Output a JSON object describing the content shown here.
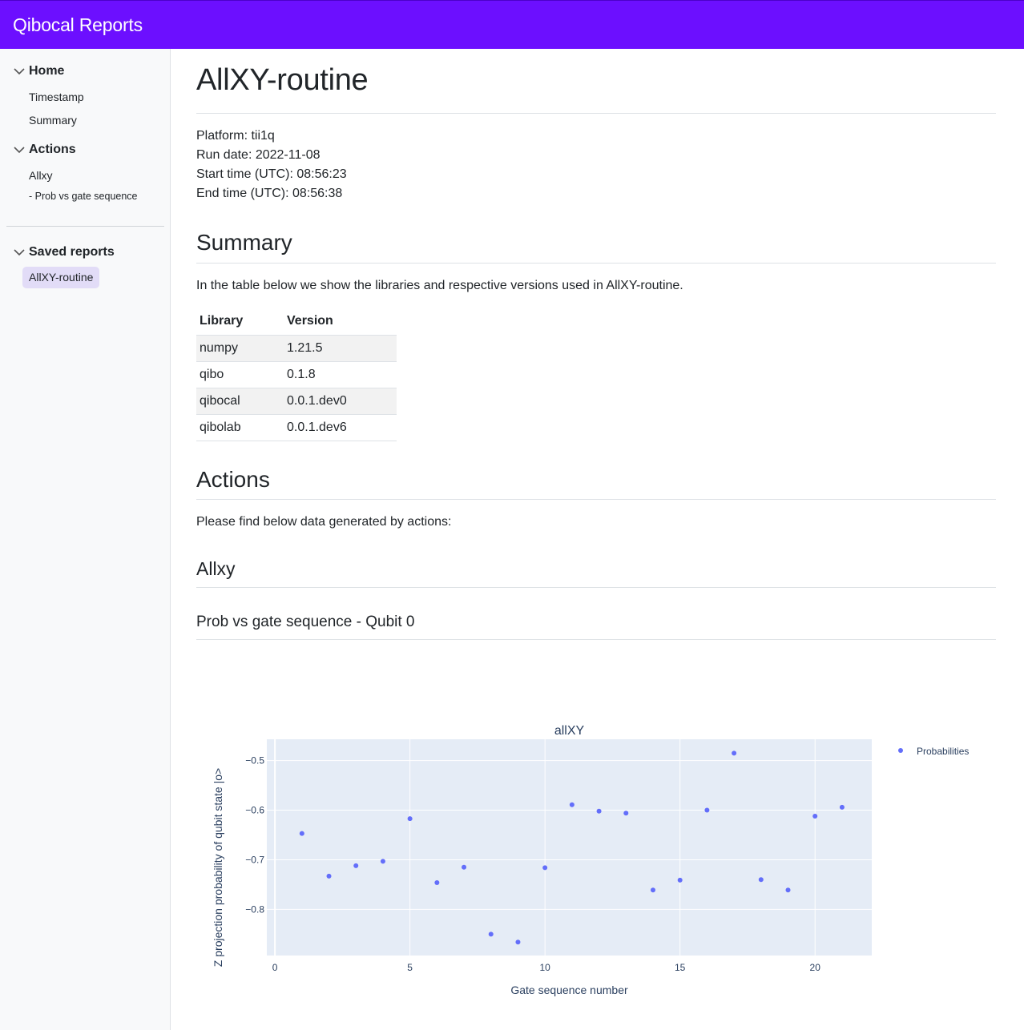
{
  "app": {
    "title": "Qibocal Reports"
  },
  "sidebar": {
    "groups": [
      {
        "label": "Home",
        "items": [
          "Timestamp",
          "Summary"
        ]
      },
      {
        "label": "Actions",
        "items": [
          "Allxy",
          "- Prob vs gate sequence"
        ]
      },
      {
        "label": "Saved reports",
        "items": [
          "AllXY-routine"
        ]
      }
    ]
  },
  "page": {
    "title": "AllXY-routine",
    "meta": [
      "Platform: tii1q",
      "Run date: 2022-11-08",
      "Start time (UTC): 08:56:23",
      "End time (UTC): 08:56:38"
    ],
    "summary_heading": "Summary",
    "summary_text": "In the table below we show the libraries and respective versions used in AllXY-routine.",
    "table": {
      "headers": [
        "Library",
        "Version"
      ],
      "rows": [
        [
          "numpy",
          "1.21.5"
        ],
        [
          "qibo",
          "0.1.8"
        ],
        [
          "qibocal",
          "0.0.1.dev0"
        ],
        [
          "qibolab",
          "0.0.1.dev6"
        ]
      ]
    },
    "actions_heading": "Actions",
    "actions_text": "Please find below data generated by actions:",
    "allxy_heading": "Allxy",
    "plot_heading": "Prob vs gate sequence - Qubit 0"
  },
  "colors": {
    "topbar": "#6c0fff",
    "active_item": "#e2dcf7",
    "plot_bg": "#e5ecf6",
    "marker": "#636efa"
  },
  "chart_data": {
    "type": "scatter",
    "title": "allXY",
    "xlabel": "Gate sequence number",
    "ylabel": "Z projection probability of qubit state |o>",
    "xlim": [
      -0.3,
      22.1
    ],
    "ylim": [
      -0.893,
      -0.457
    ],
    "xticks": [
      0,
      5,
      10,
      15,
      20
    ],
    "yticks": [
      -0.5,
      -0.6,
      -0.7,
      -0.8
    ],
    "xtick_labels": [
      "0",
      "5",
      "10",
      "15",
      "20"
    ],
    "ytick_labels": [
      "−0.5",
      "−0.6",
      "−0.7",
      "−0.8"
    ],
    "grid": true,
    "legend_position": "top-right",
    "series": [
      {
        "name": "Probabilities",
        "x": [
          1,
          2,
          3,
          4,
          5,
          6,
          7,
          8,
          9,
          10,
          11,
          12,
          13,
          14,
          15,
          16,
          17,
          18,
          19,
          20,
          21
        ],
        "y": [
          -0.647,
          -0.733,
          -0.712,
          -0.703,
          -0.617,
          -0.746,
          -0.715,
          -0.85,
          -0.866,
          -0.716,
          -0.589,
          -0.602,
          -0.606,
          -0.761,
          -0.741,
          -0.6,
          -0.485,
          -0.74,
          -0.761,
          -0.612,
          -0.594
        ]
      }
    ]
  }
}
